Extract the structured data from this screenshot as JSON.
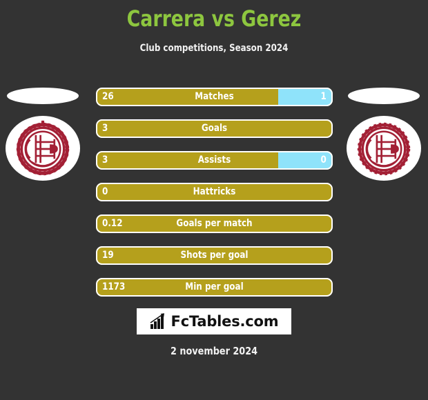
{
  "header": {
    "title": "Carrera vs Gerez",
    "subtitle": "Club competitions, Season 2024",
    "title_color": "#8DC63F"
  },
  "crests": {
    "left": {
      "name": "club-crest-lanus-left",
      "color": "#A32035"
    },
    "right": {
      "name": "club-crest-lanus-right",
      "color": "#A32035"
    }
  },
  "colors": {
    "background": "#333333",
    "home_bar": "#B5A01C",
    "away_bar": "#8FE3FA",
    "text": "#ffffff"
  },
  "chart_data": {
    "type": "bar",
    "title": "Carrera vs Gerez",
    "subtitle": "Club competitions, Season 2024",
    "orientation": "horizontal-split",
    "categories": [
      "Matches",
      "Goals",
      "Assists",
      "Hattricks",
      "Goals per match",
      "Shots per goal",
      "Min per goal"
    ],
    "series": [
      {
        "name": "Carrera",
        "values": [
          "26",
          "3",
          "3",
          "0",
          "0.12",
          "19",
          "1173"
        ]
      },
      {
        "name": "Gerez",
        "values": [
          "1",
          "",
          "0",
          "",
          "",
          "",
          ""
        ]
      }
    ]
  },
  "stats": [
    {
      "label": "Matches",
      "home": "26",
      "away": "1",
      "has_away": true,
      "home_fill_pct": 77
    },
    {
      "label": "Goals",
      "home": "3",
      "away": "",
      "has_away": false,
      "home_fill_pct": 100
    },
    {
      "label": "Assists",
      "home": "3",
      "away": "0",
      "has_away": true,
      "home_fill_pct": 77
    },
    {
      "label": "Hattricks",
      "home": "0",
      "away": "",
      "has_away": false,
      "home_fill_pct": 100
    },
    {
      "label": "Goals per match",
      "home": "0.12",
      "away": "",
      "has_away": false,
      "home_fill_pct": 100
    },
    {
      "label": "Shots per goal",
      "home": "19",
      "away": "",
      "has_away": false,
      "home_fill_pct": 100
    },
    {
      "label": "Min per goal",
      "home": "1173",
      "away": "",
      "has_away": false,
      "home_fill_pct": 100
    }
  ],
  "footer": {
    "logo_text": "FcTables.com",
    "logo_icon": "bar-chart-growth-icon",
    "date": "2 november 2024"
  }
}
